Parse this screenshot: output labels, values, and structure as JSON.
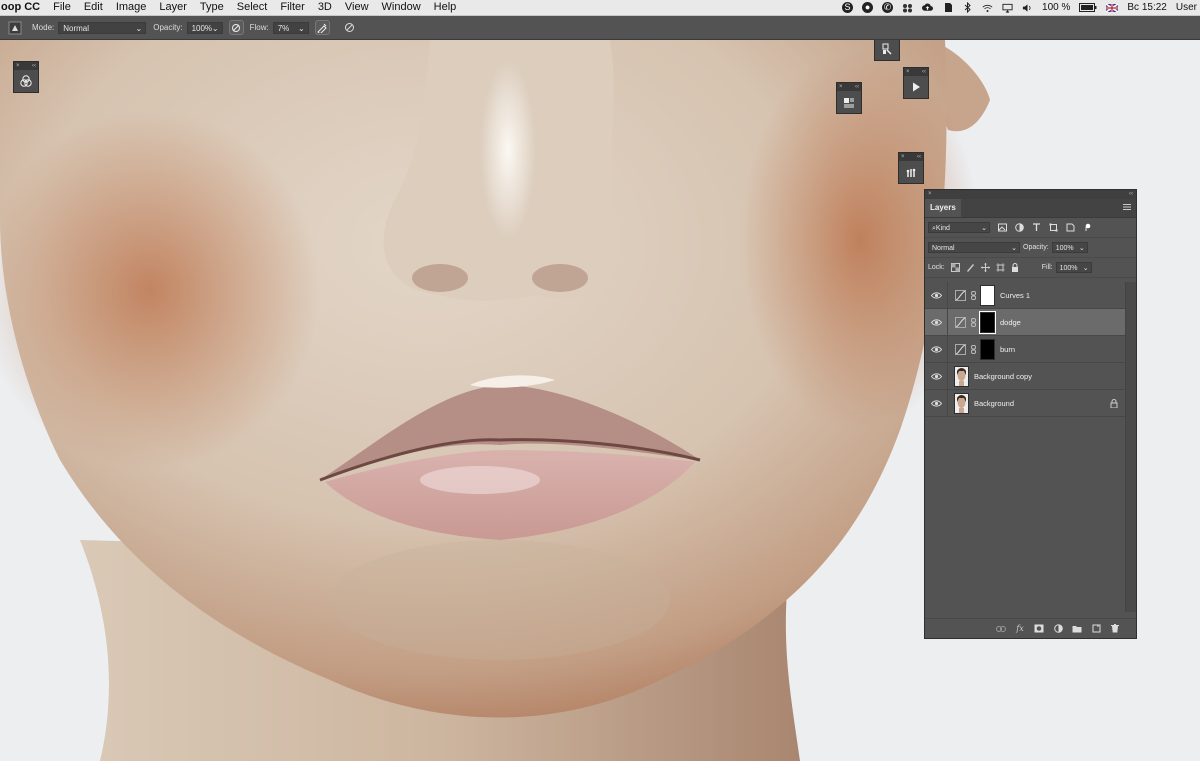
{
  "menubar": {
    "app_name": "oop CC",
    "items": [
      "File",
      "Edit",
      "Image",
      "Layer",
      "Type",
      "Select",
      "Filter",
      "3D",
      "View",
      "Window",
      "Help"
    ],
    "battery": "100 %",
    "clock": "Вс 15:22",
    "user": "User"
  },
  "options_bar": {
    "mode_label": "Mode:",
    "mode_value": "Normal",
    "opacity_label": "Opacity:",
    "opacity_value": "100%",
    "flow_label": "Flow:",
    "flow_value": "7%"
  },
  "layers_panel": {
    "tab_label": "Layers",
    "filter_kind": "Kind",
    "blend_mode": "Normal",
    "opacity_label": "Opacity:",
    "opacity_value": "100%",
    "lock_label": "Lock:",
    "fill_label": "Fill:",
    "fill_value": "100%",
    "layers": [
      {
        "name": "Curves 1",
        "type": "adjustment",
        "mask": "white",
        "selected": false
      },
      {
        "name": "dodge",
        "type": "adjustment",
        "mask": "black",
        "selected": true
      },
      {
        "name": "burn",
        "type": "adjustment",
        "mask": "black",
        "selected": false
      },
      {
        "name": "Background copy",
        "type": "pixel",
        "selected": false
      },
      {
        "name": "Background",
        "type": "pixel",
        "locked": true,
        "selected": false
      }
    ]
  },
  "colors": {
    "ui_dark": "#535353",
    "panel_bg": "#535353",
    "selected_row": "#6b6b6b"
  }
}
